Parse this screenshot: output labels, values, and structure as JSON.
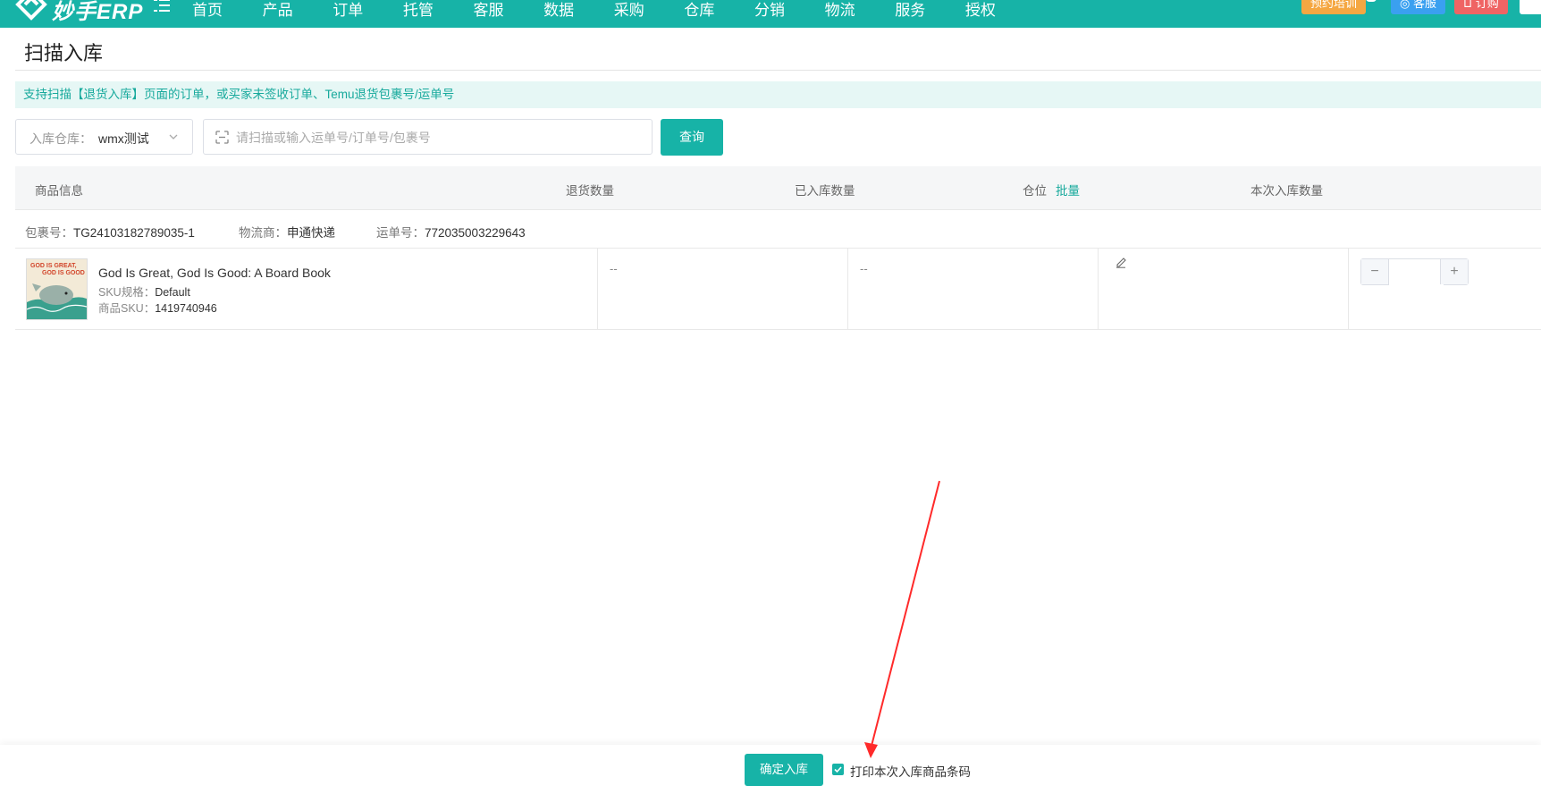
{
  "app": {
    "logo_text": "妙手ERP",
    "nav": [
      "首页",
      "产品",
      "订单",
      "托管",
      "客服",
      "数据",
      "采购",
      "仓库",
      "分销",
      "物流",
      "服务",
      "授权"
    ],
    "badges": {
      "training": "预约培训",
      "service": "客服",
      "order": "订购"
    }
  },
  "page": {
    "title": "扫描入库",
    "notice": "支持扫描【退货入库】页面的订单，或买家未签收订单、Temu退货包裹号/运单号"
  },
  "filters": {
    "warehouse_label": "入库仓库：",
    "warehouse_value": "wmx测试",
    "scan_placeholder": "请扫描或输入运单号/订单号/包裹号",
    "scan_value": "",
    "query_label": "查询"
  },
  "table": {
    "headers": {
      "product": "商品信息",
      "return_qty": "退货数量",
      "stocked_qty": "已入库数量",
      "location": "仓位",
      "batch": "批量",
      "this_qty": "本次入库数量"
    },
    "package": {
      "package_key": "包裹号：",
      "package_no": "TG24103182789035-1",
      "carrier_key": "物流商：",
      "carrier": "申通快递",
      "waybill_key": "运单号：",
      "waybill_no": "772035003229643"
    },
    "rows": [
      {
        "title": "God Is Great, God Is Good: A Board Book",
        "sku_spec_key": "SKU规格：",
        "sku_spec": "Default",
        "sku_key": "商品SKU：",
        "sku": "1419740946",
        "thumb_text_1": "GOD IS GREAT,",
        "thumb_text_2": "GOD IS GOOD",
        "return_qty": "--",
        "stocked_qty": "--",
        "this_qty": ""
      }
    ]
  },
  "footer": {
    "confirm_label": "确定入库",
    "print_label": "打印本次入库商品条码",
    "print_checked": true
  },
  "colors": {
    "accent": "#17b3a7",
    "annotation_arrow": "#ff2a2a"
  }
}
